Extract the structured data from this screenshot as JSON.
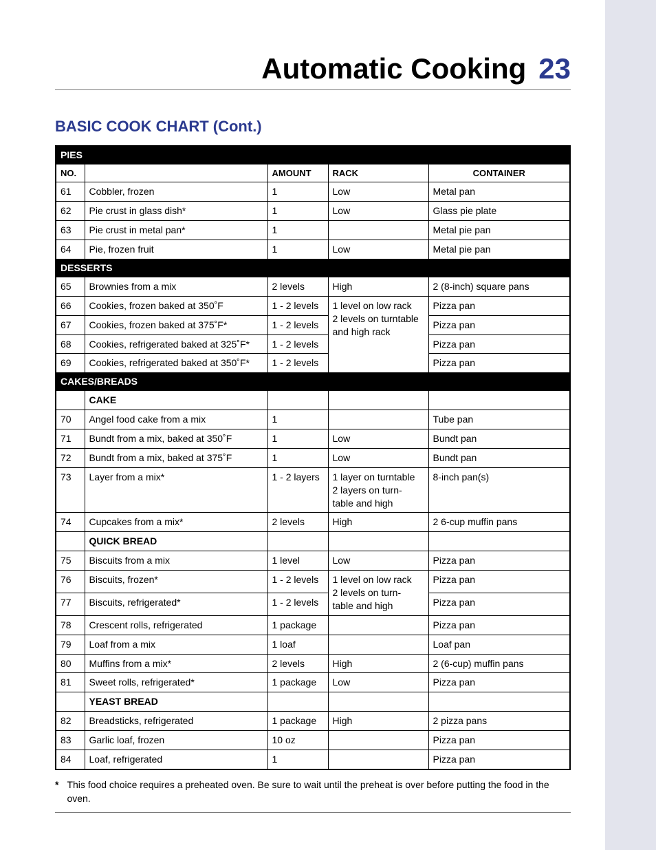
{
  "header": {
    "title": "Automatic Cooking",
    "page_number": "23"
  },
  "section_title": "BASIC COOK CHART (Cont.)",
  "columns": {
    "no": "NO.",
    "amount": "AMOUNT",
    "rack": "RACK",
    "container": "CONTAINER"
  },
  "sections": {
    "pies": {
      "label": "Pies",
      "rows": [
        {
          "no": "61",
          "name": "Cobbler, frozen",
          "amount": "1",
          "rack": "Low",
          "container": "Metal pan"
        },
        {
          "no": "62",
          "name": "Pie crust in glass dish*",
          "amount": "1",
          "rack": "Low",
          "container": "Glass pie plate"
        },
        {
          "no": "63",
          "name": "Pie crust in metal pan*",
          "amount": "1",
          "rack": "",
          "container": "Metal pie pan"
        },
        {
          "no": "64",
          "name": "Pie, frozen fruit",
          "amount": "1",
          "rack": "Low",
          "container": "Metal pie pan"
        }
      ]
    },
    "desserts": {
      "label": "Desserts",
      "rack_merged": "1 level on low rack\n2 levels on turntable and high rack",
      "rows": [
        {
          "no": "65",
          "name": "Brownies from a mix",
          "amount": "2 levels",
          "rack": "High",
          "container": "2 (8-inch) square pans"
        },
        {
          "no": "66",
          "name": "Cookies, frozen baked at 350˚F",
          "amount": "1 - 2 levels",
          "container": "Pizza pan"
        },
        {
          "no": "67",
          "name": "Cookies, frozen baked at 375˚F*",
          "amount": "1 - 2 levels",
          "container": "Pizza pan"
        },
        {
          "no": "68",
          "name": "Cookies, refrigerated baked at 325˚F*",
          "amount": "1 - 2 levels",
          "container": "Pizza pan"
        },
        {
          "no": "69",
          "name": "Cookies, refrigerated baked at 350˚F*",
          "amount": "1 - 2 levels",
          "container": "Pizza pan"
        }
      ]
    },
    "cakes_breads": {
      "label": "Cakes/Breads",
      "cake": {
        "label": "Cake",
        "rows": [
          {
            "no": "70",
            "name": "Angel food cake from a mix",
            "amount": "1",
            "rack": "",
            "container": "Tube pan"
          },
          {
            "no": "71",
            "name": "Bundt from a mix, baked at 350˚F",
            "amount": "1",
            "rack": "Low",
            "container": "Bundt pan"
          },
          {
            "no": "72",
            "name": "Bundt from a mix, baked at 375˚F",
            "amount": "1",
            "rack": "Low",
            "container": "Bundt pan"
          },
          {
            "no": "73",
            "name": "Layer from a mix*",
            "amount": "1 - 2 layers",
            "rack": "1 layer on turntable\n2 layers on turn-\ntable and high",
            "container": "8-inch pan(s)"
          },
          {
            "no": "74",
            "name": "Cupcakes from a mix*",
            "amount": "2 levels",
            "rack": "High",
            "container": "2 6-cup muffin pans"
          }
        ]
      },
      "quick_bread": {
        "label": "Quick Bread",
        "rack_merged": "1 level on low rack\n2 levels on turn-\ntable and high",
        "rows": [
          {
            "no": "75",
            "name": "Biscuits from a mix",
            "amount": "1 level",
            "rack": "Low",
            "container": "Pizza pan"
          },
          {
            "no": "76",
            "name": "Biscuits, frozen*",
            "amount": "1 - 2 levels",
            "container": "Pizza pan"
          },
          {
            "no": "77",
            "name": "Biscuits, refrigerated*",
            "amount": "1 - 2 levels",
            "container": "Pizza pan"
          },
          {
            "no": "78",
            "name": "Crescent rolls, refrigerated",
            "amount": "1 package",
            "rack": "",
            "container": "Pizza pan"
          },
          {
            "no": "79",
            "name": "Loaf from a mix",
            "amount": "1 loaf",
            "rack": "",
            "container": "Loaf pan"
          },
          {
            "no": "80",
            "name": "Muffins from a mix*",
            "amount": "2 levels",
            "rack": "High",
            "container": "2 (6-cup) muffin pans"
          },
          {
            "no": "81",
            "name": "Sweet rolls, refrigerated*",
            "amount": "1 package",
            "rack": "Low",
            "container": "Pizza pan"
          }
        ]
      },
      "yeast_bread": {
        "label": "Yeast Bread",
        "rows": [
          {
            "no": "82",
            "name": "Breadsticks, refrigerated",
            "amount": "1 package",
            "rack": "High",
            "container": "2 pizza pans"
          },
          {
            "no": "83",
            "name": "Garlic loaf, frozen",
            "amount": "10 oz",
            "rack": "",
            "container": "Pizza pan"
          },
          {
            "no": "84",
            "name": "Loaf, refrigerated",
            "amount": "1",
            "rack": "",
            "container": "Pizza pan"
          }
        ]
      }
    }
  },
  "footnote": {
    "symbol": "*",
    "text": "This food choice requires a preheated oven. Be sure to wait until the preheat is over before putting the food in the oven."
  }
}
